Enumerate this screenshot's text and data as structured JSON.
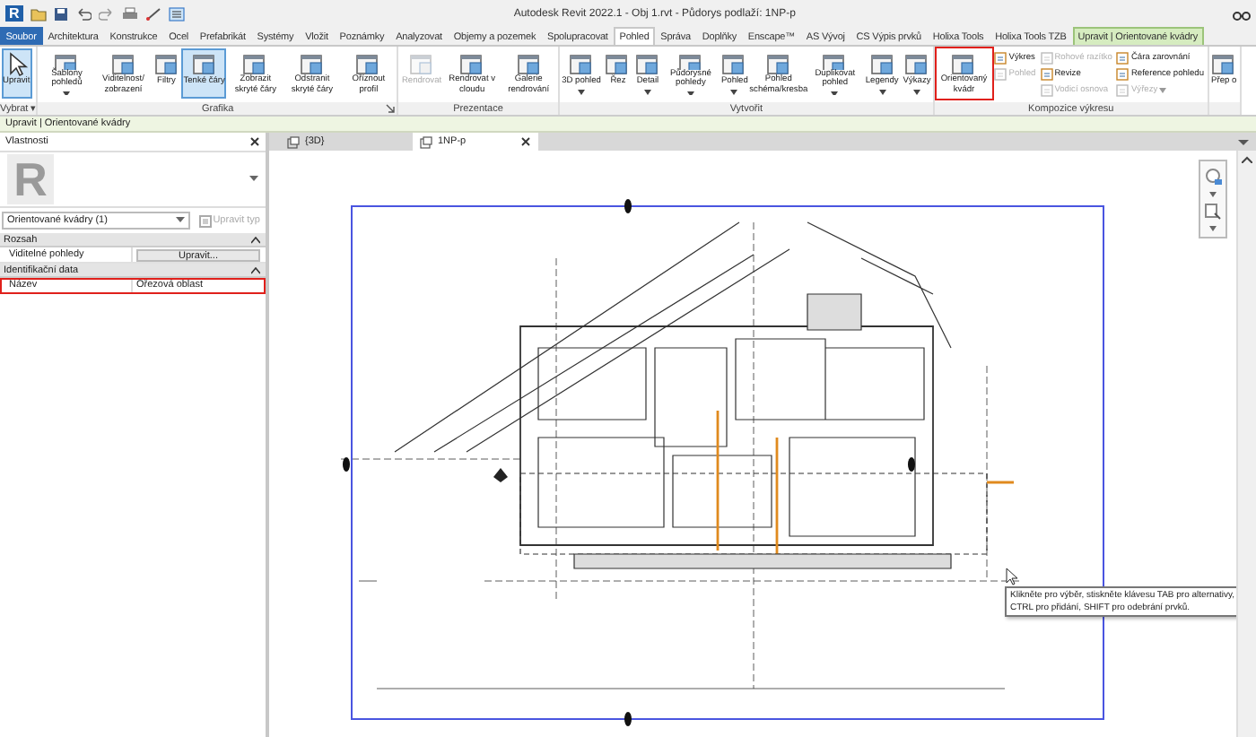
{
  "title_bar": {
    "logo": "R",
    "title": "Autodesk Revit 2022.1 - Obj 1.rvt - Půdorys podlaží: 1NP-p"
  },
  "ribbon_tabs": [
    {
      "label": "Soubor",
      "kind": "file",
      "selected": false
    },
    {
      "label": "Architektura",
      "kind": "normal",
      "selected": false
    },
    {
      "label": "Konstrukce",
      "kind": "normal",
      "selected": false
    },
    {
      "label": "Ocel",
      "kind": "normal",
      "selected": false
    },
    {
      "label": "Prefabrikát",
      "kind": "normal",
      "selected": false
    },
    {
      "label": "Systémy",
      "kind": "normal",
      "selected": false
    },
    {
      "label": "Vložit",
      "kind": "normal",
      "selected": false
    },
    {
      "label": "Poznámky",
      "kind": "normal",
      "selected": false
    },
    {
      "label": "Analyzovat",
      "kind": "normal",
      "selected": false
    },
    {
      "label": "Objemy a pozemek",
      "kind": "normal",
      "selected": false
    },
    {
      "label": "Spolupracovat",
      "kind": "normal",
      "selected": false
    },
    {
      "label": "Pohled",
      "kind": "normal",
      "selected": true
    },
    {
      "label": "Správa",
      "kind": "normal",
      "selected": false
    },
    {
      "label": "Doplňky",
      "kind": "normal",
      "selected": false
    },
    {
      "label": "Enscape™",
      "kind": "normal",
      "selected": false
    },
    {
      "label": "AS Vývoj",
      "kind": "normal",
      "selected": false
    },
    {
      "label": "CS Výpis prvků",
      "kind": "normal",
      "selected": false
    },
    {
      "label": "Holixa Tools",
      "kind": "normal",
      "selected": false
    },
    {
      "label": "Holixa Tools TZB",
      "kind": "normal",
      "selected": false
    },
    {
      "label": "Upravit | Orientované kvádry",
      "kind": "context",
      "selected": false
    }
  ],
  "ribbon_panels": [
    {
      "label": "Vybrat ▾",
      "launcher": false,
      "buttons": [
        {
          "kind": "large",
          "label": "Upravit",
          "selected": true,
          "disabled": false,
          "menu": false,
          "highlighted": false
        }
      ]
    },
    {
      "label": "Grafika",
      "launcher": true,
      "buttons": [
        {
          "kind": "large",
          "label": "Šablony pohledů",
          "selected": false,
          "disabled": false,
          "menu": true,
          "highlighted": false
        },
        {
          "kind": "large",
          "label": "Viditelnost/ zobrazení",
          "selected": false,
          "disabled": false,
          "menu": false,
          "highlighted": false
        },
        {
          "kind": "large",
          "label": "Filtry",
          "selected": false,
          "disabled": false,
          "menu": false,
          "highlighted": false
        },
        {
          "kind": "large",
          "label": "Tenké čáry",
          "selected": true,
          "disabled": false,
          "menu": false,
          "highlighted": false
        },
        {
          "kind": "large",
          "label": "Zobrazit skryté čáry",
          "selected": false,
          "disabled": false,
          "menu": false,
          "highlighted": false
        },
        {
          "kind": "large",
          "label": "Odstranit skryté čáry",
          "selected": false,
          "disabled": false,
          "menu": false,
          "highlighted": false
        },
        {
          "kind": "large",
          "label": "Oříznout profil",
          "selected": false,
          "disabled": false,
          "menu": false,
          "highlighted": false
        }
      ]
    },
    {
      "label": "Prezentace",
      "launcher": false,
      "buttons": [
        {
          "kind": "large",
          "label": "Rendrovat",
          "selected": false,
          "disabled": true,
          "menu": false,
          "highlighted": false
        },
        {
          "kind": "large",
          "label": "Rendrovat v cloudu",
          "selected": false,
          "disabled": false,
          "menu": false,
          "highlighted": false
        },
        {
          "kind": "large",
          "label": "Galerie rendrování",
          "selected": false,
          "disabled": false,
          "menu": false,
          "highlighted": false
        }
      ]
    },
    {
      "label": "Vytvořit",
      "launcher": false,
      "buttons": [
        {
          "kind": "large",
          "label": "3D pohled",
          "selected": false,
          "disabled": false,
          "menu": true,
          "highlighted": false
        },
        {
          "kind": "large",
          "label": "Řez",
          "selected": false,
          "disabled": false,
          "menu": false,
          "highlighted": false
        },
        {
          "kind": "large",
          "label": "Detail",
          "selected": false,
          "disabled": false,
          "menu": true,
          "highlighted": false
        },
        {
          "kind": "large",
          "label": "Půdorysné pohledy",
          "selected": false,
          "disabled": false,
          "menu": true,
          "highlighted": false
        },
        {
          "kind": "large",
          "label": "Pohled",
          "selected": false,
          "disabled": false,
          "menu": true,
          "highlighted": false
        },
        {
          "kind": "large",
          "label": "Pohled schéma/kresba",
          "selected": false,
          "disabled": false,
          "menu": false,
          "highlighted": false
        },
        {
          "kind": "large",
          "label": "Duplikovat pohled",
          "selected": false,
          "disabled": false,
          "menu": true,
          "highlighted": false
        },
        {
          "kind": "large",
          "label": "Legendy",
          "selected": false,
          "disabled": false,
          "menu": true,
          "highlighted": false
        },
        {
          "kind": "large",
          "label": "Výkazy",
          "selected": false,
          "disabled": false,
          "menu": true,
          "highlighted": false
        }
      ]
    },
    {
      "label": "Kompozice výkresu",
      "launcher": false,
      "buttons": [
        {
          "kind": "large",
          "label": "Orientovaný kvádr",
          "selected": false,
          "disabled": false,
          "menu": false,
          "highlighted": true
        },
        {
          "kind": "stack",
          "items": [
            {
              "label": "Výkres",
              "disabled": false,
              "menu": false
            },
            {
              "label": "Pohled",
              "disabled": true,
              "menu": false
            }
          ]
        },
        {
          "kind": "stack",
          "items": [
            {
              "label": "Rohové razítko",
              "disabled": true,
              "menu": false
            },
            {
              "label": "Revize",
              "disabled": false,
              "menu": false
            },
            {
              "label": "Vodicí osnova",
              "disabled": true,
              "menu": false
            }
          ]
        },
        {
          "kind": "stack",
          "items": [
            {
              "label": "Čára zarovnání",
              "disabled": false,
              "menu": false
            },
            {
              "label": "Reference pohledu",
              "disabled": false,
              "menu": false
            },
            {
              "label": "Výřezy",
              "disabled": true,
              "menu": true
            }
          ]
        }
      ]
    },
    {
      "launcher": false,
      "buttons": [
        {
          "kind": "large",
          "label": "Přep o",
          "selected": false,
          "disabled": false,
          "menu": false,
          "highlighted": false
        }
      ]
    }
  ],
  "context_bar": {
    "text": "Upravit | Orientované kvádry"
  },
  "properties": {
    "title": "Vlastnosti",
    "logo": "R",
    "type_selector": "Orientované kvádry (1)",
    "edit_type": {
      "label": "Upravit typ",
      "disabled": true
    },
    "groups": [
      {
        "name": "Rozsah",
        "expanded": true,
        "rows": [
          {
            "label": "Viditelné pohledy",
            "value": "Upravit...",
            "kind": "button",
            "highlighted": false
          }
        ]
      },
      {
        "name": "Identifikační data",
        "expanded": true,
        "rows": [
          {
            "label": "Název",
            "value": "Ořezová oblast",
            "kind": "text",
            "highlighted": true
          }
        ]
      }
    ]
  },
  "view_tabs": [
    {
      "label": "{3D}",
      "selected": false,
      "closable": false
    },
    {
      "label": "1NP-p",
      "selected": true,
      "closable": true
    }
  ],
  "tooltip": {
    "text": "Klikněte pro výběr, stiskněte klávesu TAB pro alternativy, CTRL pro přidání, SHIFT pro odebrání prvků."
  }
}
